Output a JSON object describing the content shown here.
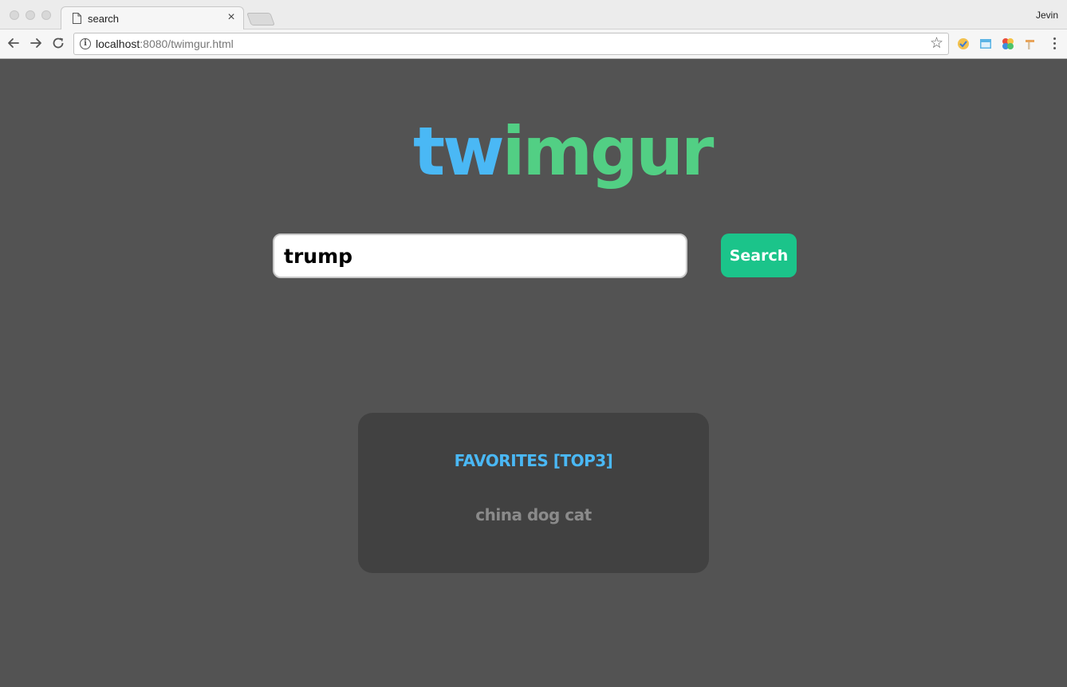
{
  "browser": {
    "tab_title": "search",
    "tab_close": "×",
    "profile_name": "Jevin",
    "url_host": "localhost",
    "url_rest": ":8080/twimgur.html"
  },
  "page": {
    "logo_part1": "tw",
    "logo_part2": "imgur",
    "search": {
      "value": "trump",
      "button_label": "Search"
    },
    "favorites": {
      "title": "FAVORITES [TOP3]",
      "items": "china dog cat"
    }
  },
  "colors": {
    "background": "#535353",
    "logo_blue": "#4ab8f5",
    "logo_green": "#52cf84",
    "search_button": "#1bc48a",
    "card": "#414141",
    "favorites_title": "#4ab8f5",
    "favorites_items": "#8a8a8a"
  }
}
